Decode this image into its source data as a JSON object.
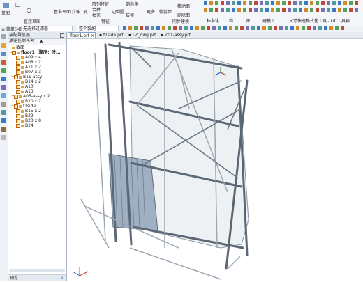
{
  "ribbon": {
    "left_label": "草图",
    "groups": [
      {
        "label": "直接草图",
        "items": [
          "□",
          "○",
          "+"
        ]
      },
      {
        "label": "特征",
        "items": [
          "基准平面",
          "拉伸",
          "孔",
          "阵列特征",
          "合并",
          "抽壳",
          "边倒圆",
          "倒斜角",
          "拔模",
          "更多",
          "修剪体",
          "移动面",
          "删除面"
        ]
      },
      {
        "label": "同步建模",
        "items": []
      },
      {
        "label": "标准化...",
        "items": [
          "标准化..."
        ]
      },
      {
        "label": "齿...",
        "items": [
          "齿..."
        ]
      },
      {
        "label": "弹...",
        "items": [
          "弹..."
        ]
      },
      {
        "label": "建模工...",
        "items": [
          "建模工..."
        ]
      },
      {
        "label": "尺寸快速格式化工具 - GC工具箱",
        "items": [
          "尺寸快速格式化工具 - GC工具箱"
        ]
      }
    ]
  },
  "toolbar2": {
    "menu_label": "≡ 菜单(M) ▾",
    "filter_value": "无选择过滤器",
    "scope_value": "整个装配"
  },
  "tabs": [
    {
      "label": "floor1.prt",
      "active": true
    },
    {
      "label": "f1side.prt",
      "active": false
    },
    {
      "label": "LZ_dwg.prt",
      "active": false
    },
    {
      "label": "Z01-assy.prt",
      "active": false
    }
  ],
  "navigator": {
    "title": "装配导航器",
    "column_header": "描述性部件名",
    "rows": [
      {
        "label": "截面",
        "indent": 0,
        "twisty": "",
        "type": "section"
      },
      {
        "label": "floor1（顺序：时...",
        "indent": 0,
        "twisty": "−",
        "type": "asm"
      },
      {
        "label": "A09 x 4",
        "indent": 2,
        "twisty": "",
        "type": "part"
      },
      {
        "label": "A08 x 2",
        "indent": 2,
        "twisty": "",
        "type": "part"
      },
      {
        "label": "A11 x 2",
        "indent": 2,
        "twisty": "",
        "type": "part"
      },
      {
        "label": "B07 x 3",
        "indent": 2,
        "twisty": "",
        "type": "part"
      },
      {
        "label": "B11-assy",
        "indent": 1,
        "twisty": "+",
        "type": "asm"
      },
      {
        "label": "B14 x 2",
        "indent": 2,
        "twisty": "",
        "type": "part"
      },
      {
        "label": "A10",
        "indent": 2,
        "twisty": "",
        "type": "part"
      },
      {
        "label": "A13",
        "indent": 2,
        "twisty": "",
        "type": "part"
      },
      {
        "label": "A06-assy x 2",
        "indent": 1,
        "twisty": "+",
        "type": "asm"
      },
      {
        "label": "B20 x 2",
        "indent": 2,
        "twisty": "",
        "type": "part"
      },
      {
        "label": "f1side",
        "indent": 1,
        "twisty": "+",
        "type": "asm"
      },
      {
        "label": "B15 x 2",
        "indent": 2,
        "twisty": "",
        "type": "part"
      },
      {
        "label": "B22",
        "indent": 2,
        "twisty": "",
        "type": "part"
      },
      {
        "label": "B23 x 8",
        "indent": 2,
        "twisty": "",
        "type": "part"
      },
      {
        "label": "B24",
        "indent": 2,
        "twisty": "",
        "type": "part"
      }
    ],
    "footer_label": "预览"
  },
  "colors": {
    "frame_steel": "#7e8a96",
    "frame_dark": "#4f5b67",
    "panel_blue": "#8fa1b4",
    "accent": "#2b6cb0"
  }
}
